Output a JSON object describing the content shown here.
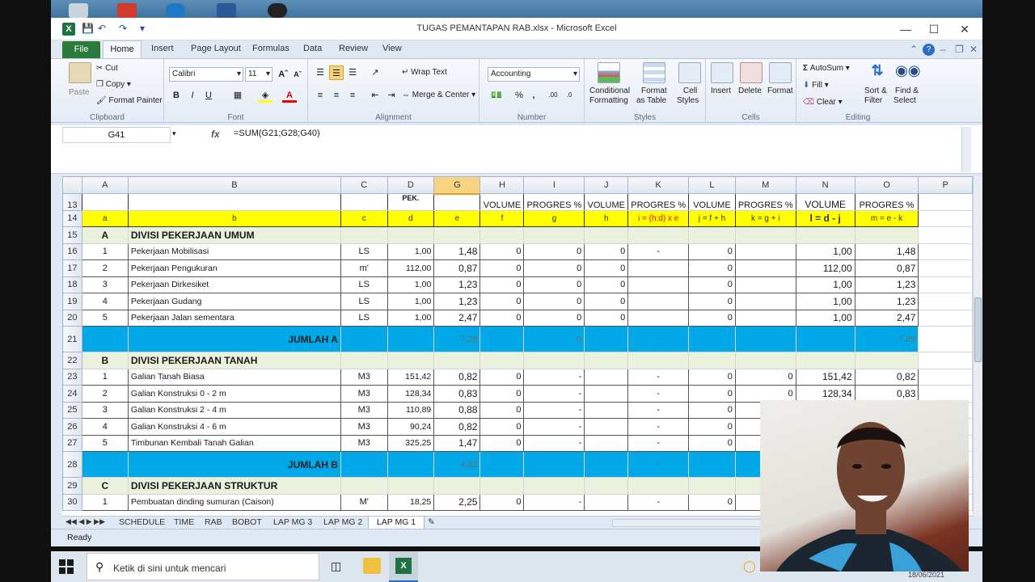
{
  "window": {
    "title": "TUGAS PEMANTAPAN RAB.xlsx  -  Microsoft Excel"
  },
  "ribbon_tabs": [
    "File",
    "Home",
    "Insert",
    "Page Layout",
    "Formulas",
    "Data",
    "Review",
    "View"
  ],
  "clipboard": {
    "paste": "Paste",
    "cut": "Cut",
    "copy": "Copy",
    "format_painter": "Format Painter",
    "label": "Clipboard"
  },
  "font": {
    "name": "Calibri",
    "size": "11",
    "label": "Font"
  },
  "alignment": {
    "wrap": "Wrap Text",
    "merge": "Merge & Center",
    "label": "Alignment"
  },
  "number": {
    "format": "Accounting",
    "label": "Number"
  },
  "styles": {
    "conditional": "Conditional",
    "conditional2": "Formatting",
    "format_table": "Format",
    "format_table2": "as Table",
    "cell": "Cell",
    "cell2": "Styles",
    "label": "Styles"
  },
  "cells": {
    "insert": "Insert",
    "delete": "Delete",
    "format": "Format",
    "label": "Cells"
  },
  "editing": {
    "autosum": "AutoSum",
    "fill": "Fill",
    "clear": "Clear",
    "sort": "Sort &",
    "sort2": "Filter",
    "find": "Find &",
    "find2": "Select",
    "label": "Editing"
  },
  "namebox": "G41",
  "formula": "=SUM(G21;G28;G40)",
  "columns": [
    "A",
    "B",
    "C",
    "D",
    "G",
    "H",
    "I",
    "J",
    "K",
    "L",
    "M",
    "N",
    "O",
    "P"
  ],
  "row13": {
    "d": "PEK.",
    "h": "VOLUME",
    "i": "PROGRES %",
    "j": "VOLUME",
    "k": "PROGRES %",
    "l": "VOLUME",
    "m": "PROGRES %",
    "n": "VOLUME",
    "o": "PROGRES %"
  },
  "row14": {
    "a": "a",
    "b": "b",
    "c": "c",
    "d": "d",
    "g": "e",
    "h": "f",
    "i": "g",
    "j": "h",
    "k": "i = (h:d) x e",
    "l": "j = f + h",
    "m": "k = g + i",
    "n": "l = d - j",
    "o": "m = e - k"
  },
  "rows": {
    "r15": {
      "n": "15",
      "a": "A",
      "b": "DIVISI PEKERJAAN UMUM"
    },
    "r16": {
      "n": "16",
      "a": "1",
      "b": "Pekerjaan Mobilisasi",
      "c": "LS",
      "d": "1,00",
      "g": "1,48",
      "h": "0",
      "i": "0",
      "j": "0",
      "k": "-",
      "l": "0",
      "m": "",
      "nn": "1,00",
      "o": "1,48"
    },
    "r17": {
      "n": "17",
      "a": "2",
      "b": "Pekerjaan Pengukuran",
      "c": "m'",
      "d": "112,00",
      "g": "0,87",
      "h": "0",
      "i": "0",
      "j": "0",
      "k": "",
      "l": "0",
      "m": "",
      "nn": "112,00",
      "o": "0,87"
    },
    "r18": {
      "n": "18",
      "a": "3",
      "b": "Pekerjaan Dirkesiket",
      "c": "LS",
      "d": "1,00",
      "g": "1,23",
      "h": "0",
      "i": "0",
      "j": "0",
      "k": "",
      "l": "0",
      "m": "",
      "nn": "1,00",
      "o": "1,23"
    },
    "r19": {
      "n": "19",
      "a": "4",
      "b": "Pekerjaan Gudang",
      "c": "LS",
      "d": "1,00",
      "g": "1,23",
      "h": "0",
      "i": "0",
      "j": "0",
      "k": "",
      "l": "0",
      "m": "",
      "nn": "1,00",
      "o": "1,23"
    },
    "r20": {
      "n": "20",
      "a": "5",
      "b": "Pekerjaan Jalan sementara",
      "c": "LS",
      "d": "1,00",
      "g": "2,47",
      "h": "0",
      "i": "0",
      "j": "0",
      "k": "",
      "l": "0",
      "m": "",
      "nn": "1,00",
      "o": "2,47"
    },
    "r21": {
      "n": "21",
      "b": "JUMLAH A",
      "g": "7,29",
      "i": "0",
      "k": "-",
      "m": "-",
      "o": "7,29"
    },
    "r22": {
      "n": "22",
      "a": "B",
      "b": "DIVISI PEKERJAAN TANAH"
    },
    "r23": {
      "n": "23",
      "a": "1",
      "b": "Galian Tanah Biasa",
      "c": "M3",
      "d": "151,42",
      "g": "0,82",
      "h": "0",
      "i": "-",
      "j": "",
      "k": "-",
      "l": "0",
      "m": "0",
      "nn": "151,42",
      "o": "0,82"
    },
    "r24": {
      "n": "24",
      "a": "2",
      "b": "Galian Konstruksi 0 - 2 m",
      "c": "M3",
      "d": "128,34",
      "g": "0,83",
      "h": "0",
      "i": "-",
      "j": "",
      "k": "-",
      "l": "0",
      "m": "0",
      "nn": "128,34",
      "o": "0,83"
    },
    "r25": {
      "n": "25",
      "a": "3",
      "b": "Galian Konstruksi 2 - 4 m",
      "c": "M3",
      "d": "110,89",
      "g": "0,88",
      "h": "0",
      "i": "-",
      "j": "",
      "k": "-",
      "l": "0"
    },
    "r26": {
      "n": "26",
      "a": "4",
      "b": "Galian Konstruksi  4 - 6 m",
      "c": "M3",
      "d": "90,24",
      "g": "0,82",
      "h": "0",
      "i": "-",
      "j": "",
      "k": "-",
      "l": "0"
    },
    "r27": {
      "n": "27",
      "a": "5",
      "b": "Timbunan Kembali Tanah Galian",
      "c": "M3",
      "d": "325,25",
      "g": "1,47",
      "h": "0",
      "i": "-",
      "j": "",
      "k": "-",
      "l": "0"
    },
    "r28": {
      "n": "28",
      "b": "JUMLAH B",
      "g": "4,82",
      "i": "-",
      "k": "-"
    },
    "r29": {
      "n": "29",
      "a": "C",
      "b": "DIVISI PEKERJAAN STRUKTUR"
    },
    "r30": {
      "n": "30",
      "a": "1",
      "b": "Pembuatan dinding sumuran (Caison)",
      "c": "M'",
      "d": "18,25",
      "g": "2,25",
      "h": "0",
      "i": "-",
      "j": "",
      "k": "-",
      "l": "0"
    }
  },
  "sheet_tabs": [
    "SCHEDULE",
    "TIME",
    "RAB",
    "BOBOT",
    "LAP MG 3",
    "LAP MG 2",
    "LAP MG 1"
  ],
  "status": "Ready",
  "taskbar": {
    "search_placeholder": "Ketik di sini untuk mencari",
    "date": "18/06/2021"
  }
}
